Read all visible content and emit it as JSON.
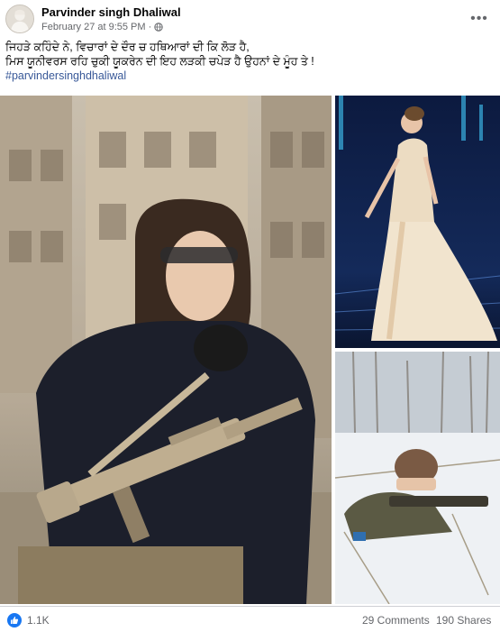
{
  "post": {
    "author": "Parvinder singh Dhaliwal",
    "timestamp": "February 27 at 9:55 PM",
    "privacy_icon": "globe-icon",
    "more_icon": "•••",
    "text_line_1": "ਜਿਹੜੇ ਕਹਿੰਦੇ ਨੇ, ਵਿਚਾਰਾਂ ਦੇ ਦੌਰ ਚ ਹਥਿਆਰਾਂ ਦੀ ਕਿ ਲੋੜ ਹੈ,",
    "text_line_2": "ਮਿਸ ਯੂਨੀਵਰਸ ਰਹਿ ਚੁਕੀ ਯੂਕਰੇਨ ਦੀ ਇਹ ਲੜਕੀ ਚਪੇੜ ਹੈ ਉਹਨਾਂ ਦੇ ਮੂੰਹ ਤੇ !",
    "hashtag": "#parvindersinghdhaliwal"
  },
  "media": {
    "photos": [
      {
        "subject": "woman in tactical gear holding rifle"
      },
      {
        "subject": "woman in white gown on stage"
      },
      {
        "subject": "soldier aiming rifle in snow"
      }
    ]
  },
  "stats": {
    "reaction_icon": "like-icon",
    "reaction_color": "#1877f2",
    "likes": "1.1K",
    "comments": "29 Comments",
    "shares": "190 Shares"
  }
}
